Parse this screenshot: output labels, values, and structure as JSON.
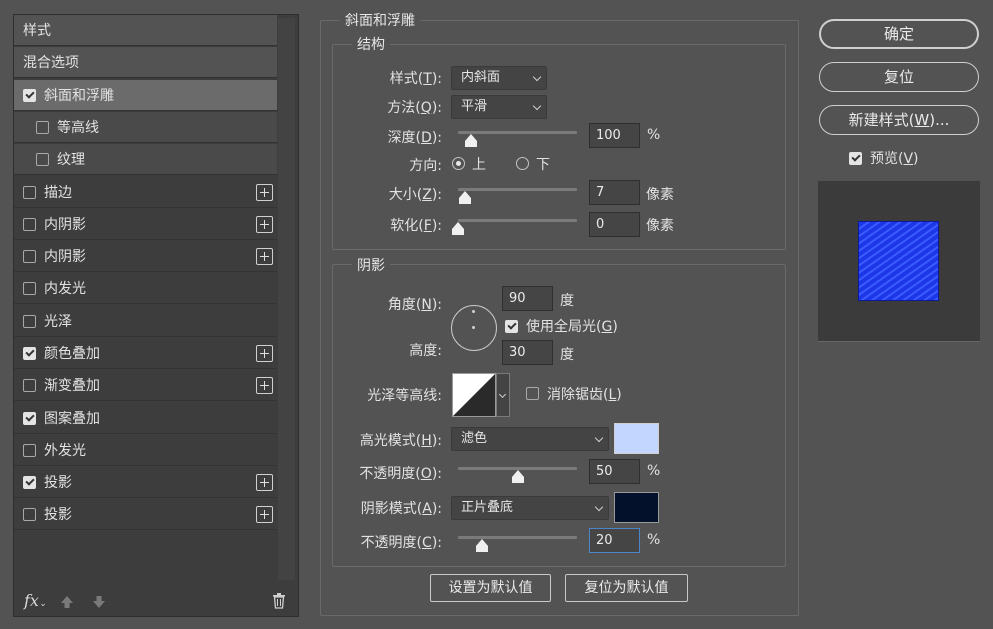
{
  "left_panel": {
    "items": [
      {
        "label": "样式",
        "type": "header"
      },
      {
        "label": "混合选项",
        "type": "header"
      },
      {
        "label": "斜面和浮雕",
        "checked": true,
        "selected": true,
        "plus": false
      },
      {
        "label": "等高线",
        "checked": false,
        "sub": true,
        "plus": false
      },
      {
        "label": "纹理",
        "checked": false,
        "sub": true,
        "plus": false
      },
      {
        "label": "描边",
        "checked": false,
        "plus": true
      },
      {
        "label": "内阴影",
        "checked": false,
        "plus": true
      },
      {
        "label": "内阴影",
        "checked": false,
        "plus": true
      },
      {
        "label": "内发光",
        "checked": false,
        "plus": false
      },
      {
        "label": "光泽",
        "checked": false,
        "plus": false
      },
      {
        "label": "颜色叠加",
        "checked": true,
        "plus": true
      },
      {
        "label": "渐变叠加",
        "checked": false,
        "plus": true
      },
      {
        "label": "图案叠加",
        "checked": true,
        "plus": false
      },
      {
        "label": "外发光",
        "checked": false,
        "plus": false
      },
      {
        "label": "投影",
        "checked": true,
        "plus": true
      },
      {
        "label": "投影",
        "checked": false,
        "plus": true
      }
    ],
    "fx_label": "fx"
  },
  "bevel": {
    "section_title": "斜面和浮雕",
    "structure": {
      "title": "结构",
      "style_label": "样式(T):",
      "style_value": "内斜面",
      "technique_label": "方法(Q):",
      "technique_value": "平滑",
      "depth_label": "深度(D):",
      "depth_value": "100",
      "depth_fraction": 0.11,
      "depth_unit": "%",
      "direction_label": "方向:",
      "direction_up": "上",
      "direction_down": "下",
      "size_label": "大小(Z):",
      "size_value": "7",
      "size_fraction": 0.06,
      "size_unit": "像素",
      "soften_label": "软化(F):",
      "soften_value": "0",
      "soften_fraction": 0.0,
      "soften_unit": "像素"
    },
    "shading": {
      "title": "阴影",
      "angle_label": "角度(N):",
      "angle_value": "90",
      "angle_unit": "度",
      "global_light_label": "使用全局光(G)",
      "global_light_checked": true,
      "altitude_label": "高度:",
      "altitude_value": "30",
      "altitude_unit": "度",
      "gloss_contour_label": "光泽等高线:",
      "anti_alias_label": "消除锯齿(L)",
      "anti_alias_checked": false,
      "highlight_mode_label": "高光模式(H):",
      "highlight_mode_value": "滤色",
      "highlight_color": "#c2d6ff",
      "highlight_opacity_label": "不透明度(O):",
      "highlight_opacity_value": "50",
      "highlight_opacity_fraction": 0.5,
      "highlight_opacity_unit": "%",
      "shadow_mode_label": "阴影模式(A):",
      "shadow_mode_value": "正片叠底",
      "shadow_color": "#03112b",
      "shadow_opacity_label": "不透明度(C):",
      "shadow_opacity_value": "20",
      "shadow_opacity_fraction": 0.2,
      "shadow_opacity_unit": "%"
    },
    "make_default_label": "设置为默认值",
    "reset_default_label": "复位为默认值"
  },
  "right_panel": {
    "ok_label": "确定",
    "reset_label": "复位",
    "new_style_label": "新建样式(W)...",
    "preview_label": "预览(V)",
    "preview_checked": true,
    "preview_color": "#1a3ee0"
  }
}
